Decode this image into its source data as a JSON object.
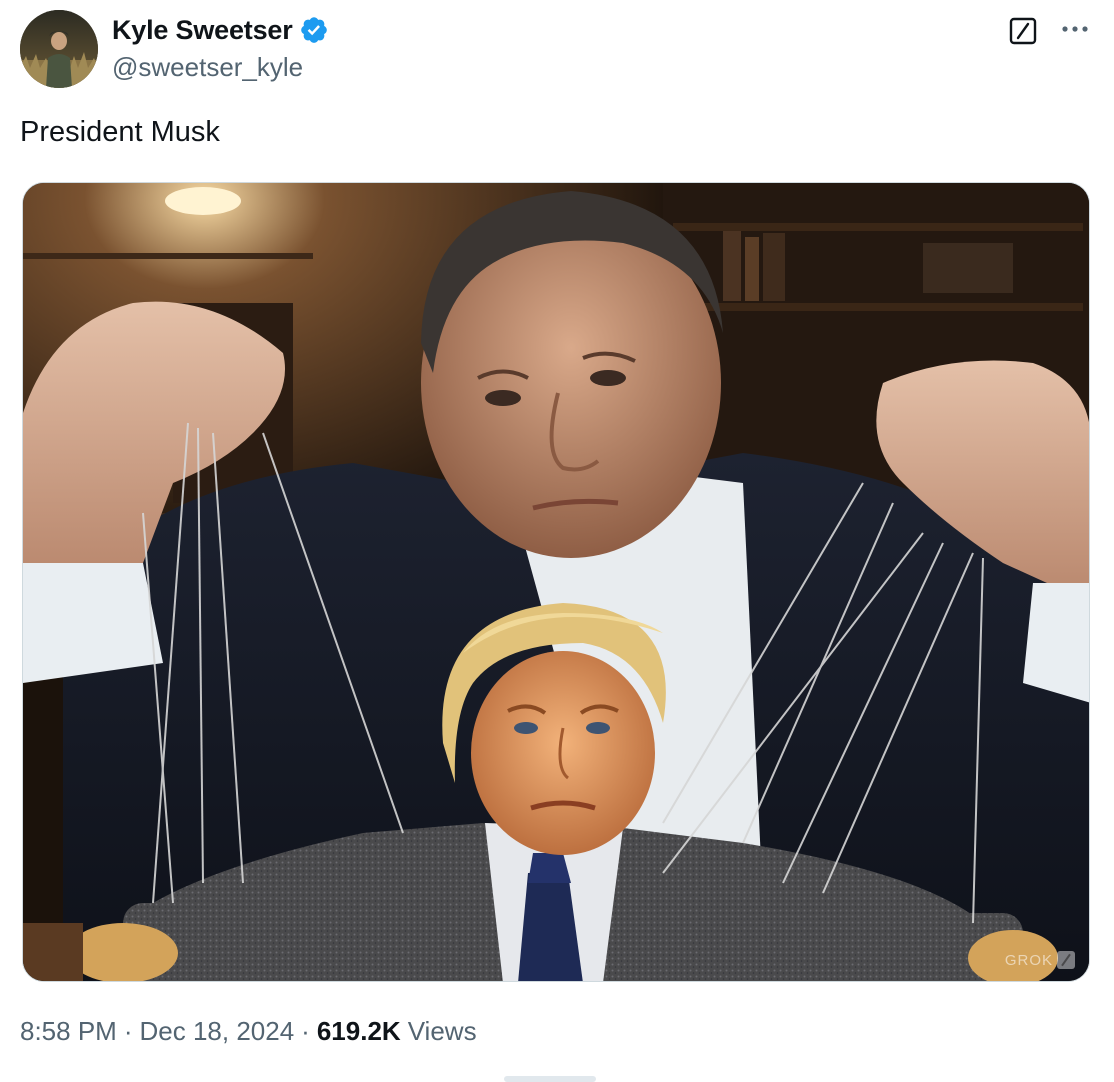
{
  "author": {
    "display_name": "Kyle Sweetser",
    "handle": "@sweetser_kyle",
    "verified": true,
    "verified_color": "#1d9bf0"
  },
  "tweet": {
    "text": "President Musk"
  },
  "media": {
    "type": "image",
    "watermark": "GROK"
  },
  "meta": {
    "time": "8:58 PM",
    "separator": "·",
    "date": "Dec 18, 2024",
    "views_count": "619.2K",
    "views_label": "Views"
  },
  "icons": {
    "grok": "grok-icon",
    "more": "more-icon",
    "verified": "verified-badge-icon"
  },
  "colors": {
    "text_primary": "#0f1419",
    "text_secondary": "#536471",
    "border": "#cfd9de"
  }
}
